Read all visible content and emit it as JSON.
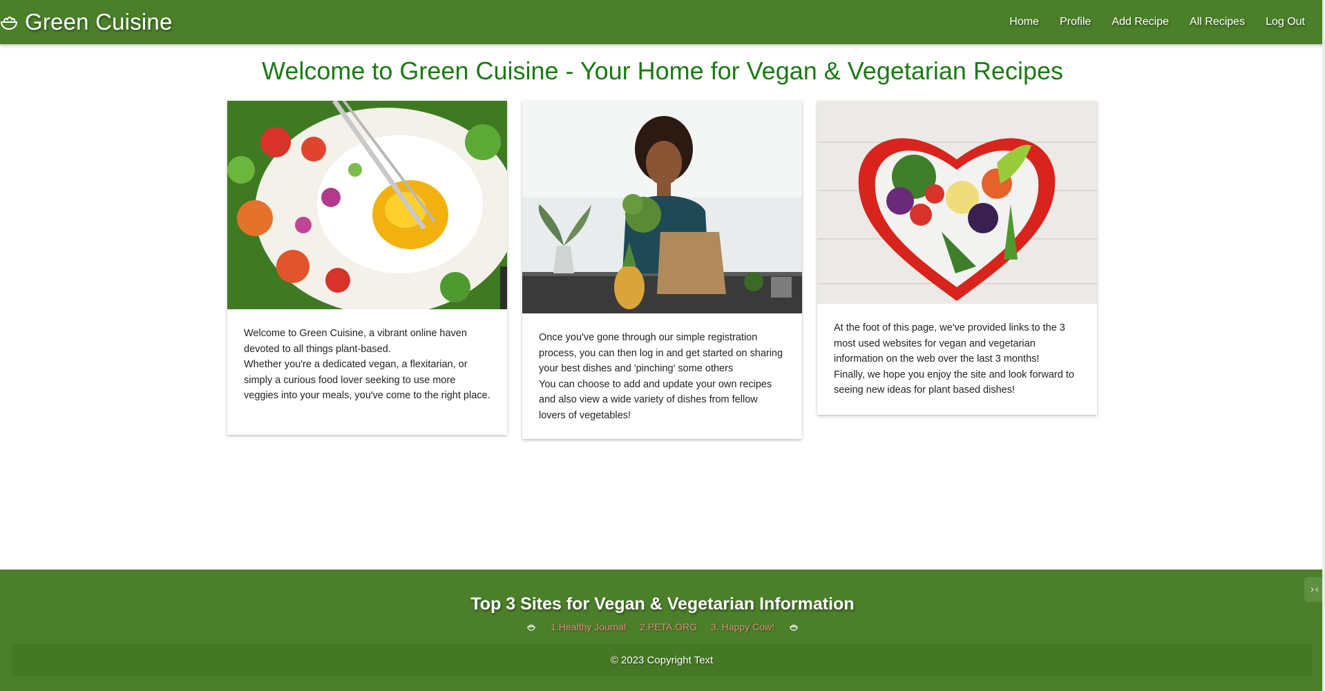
{
  "brand": {
    "title": "Green Cuisine",
    "icon": "salad-bowl-icon"
  },
  "nav": {
    "items": [
      {
        "label": "Home"
      },
      {
        "label": "Profile"
      },
      {
        "label": "Add Recipe"
      },
      {
        "label": "All Recipes"
      },
      {
        "label": "Log Out"
      }
    ]
  },
  "main": {
    "heading": "Welcome to Green Cuisine - Your Home for Vegan & Vegetarian Recipes",
    "cards": [
      {
        "image": "salad-with-fried-egg-photo",
        "lines": [
          "Welcome to Green Cuisine, a vibrant online haven devoted to all things plant-based.",
          "Whether you're a dedicated vegan, a flexitarian, or simply a curious food lover seeking to use more veggies into your meals, you've come to the right place."
        ]
      },
      {
        "image": "woman-unpacking-groceries-photo",
        "lines": [
          "Once you've gone through our simple registration process, you can then log in and get started on sharing your best dishes and 'pinching' some others",
          "You can choose to add and update your own recipes and also view a wide variety of dishes from fellow lovers of vegetables!"
        ]
      },
      {
        "image": "heart-shaped-vegetable-bowl-photo",
        "lines": [
          "At the foot of this page, we've provided links to the 3 most used websites for vegan and vegetarian information on the web over the last 3 months!",
          "Finally, we hope you enjoy the site and look forward to seeing new ideas for plant based dishes!"
        ]
      }
    ]
  },
  "footer": {
    "title": "Top 3 Sites for Vegan & Vegetarian Information",
    "links": [
      {
        "label": "1.Healthy Journal"
      },
      {
        "label": "2.PETA.ORG"
      },
      {
        "label": "3. Happy Cow!"
      }
    ],
    "copyright": "© 2023 Copyright Text"
  },
  "colors": {
    "primary": "#4b7f2a",
    "heading": "#1a7a12",
    "footer_link": "#e08a7e"
  }
}
